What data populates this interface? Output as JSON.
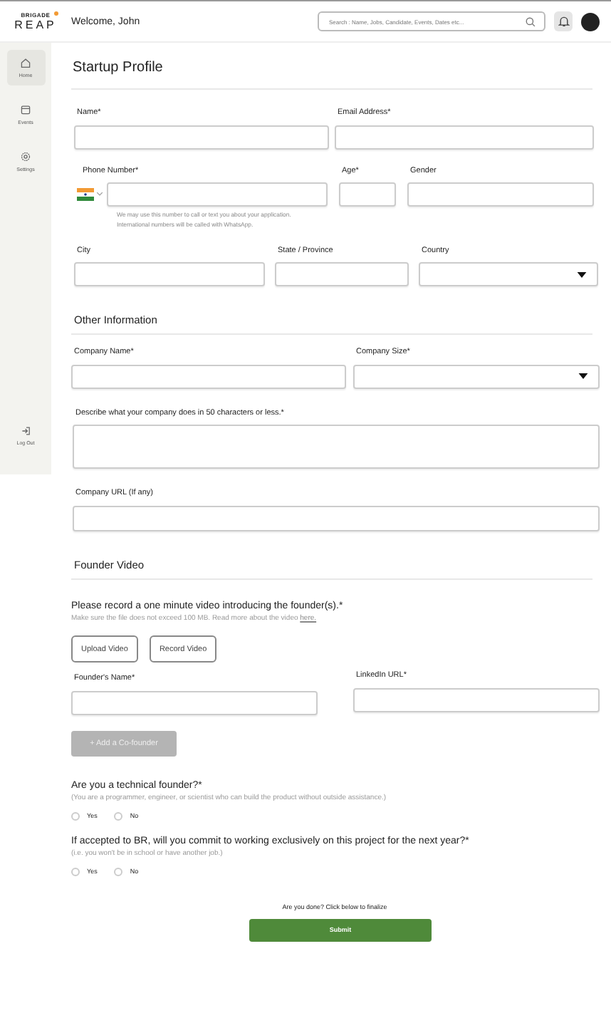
{
  "header": {
    "logo_top": "BRIGADE",
    "logo_bottom": "REAP",
    "welcome": "Welcome, John",
    "search_placeholder": "Search : Name, Jobs, Candidate, Events, Dates etc..."
  },
  "sidebar": {
    "items": [
      {
        "label": "Home",
        "kind": "home",
        "selected": true
      },
      {
        "label": "Events",
        "kind": "calendar",
        "selected": false
      },
      {
        "label": "Settings",
        "kind": "gear",
        "selected": false
      }
    ],
    "logout": "Log Out"
  },
  "form": {
    "title": "Startup Profile",
    "row_1": [
      {
        "label": "Name*",
        "kind": "text"
      },
      {
        "label": "Email Address*",
        "kind": "text"
      }
    ],
    "phone": {
      "label": "Phone Number*",
      "help": "We may use this number to call or text you about your application. International numbers will be called with WhatsApp."
    },
    "row_2": [
      {
        "label": "Age*",
        "kind": "text"
      },
      {
        "label": "Gender",
        "kind": "text"
      }
    ],
    "row_3": [
      {
        "label": "City",
        "kind": "text"
      },
      {
        "label": "State / Province",
        "kind": "text"
      },
      {
        "label": "Country",
        "kind": "select"
      }
    ],
    "other_heading": "Other Information",
    "row_4": [
      {
        "label": "Company Name*",
        "kind": "text"
      },
      {
        "label": "Company Size*",
        "kind": "select"
      }
    ],
    "describe": {
      "label": "Describe what your company does in 50 characters or less.*",
      "kind": "textarea"
    },
    "url": {
      "label": "Company URL (If any)",
      "kind": "text"
    },
    "video_heading": "Founder Video",
    "video_prompt": "Please record a one minute video introducing the founder(s).*",
    "video_note": "Make sure the file does not exceed 100 MB. Read more about the video",
    "video_link": "here.",
    "video_buttons": [
      "Upload Video",
      "Record Video"
    ],
    "row_5": [
      {
        "label": "Founder's Name*",
        "kind": "text"
      },
      {
        "label": "LinkedIn URL*",
        "kind": "text"
      }
    ],
    "add_cofounder": {
      "label": "+ Add a Co-founder",
      "disabled": true
    },
    "questions": [
      {
        "title": "Are you a technical founder?*",
        "note": "(You are a programmer, engineer, or scientist who can build the product without outside assistance.)",
        "options": [
          {
            "label": "Yes",
            "selected": false
          },
          {
            "label": "No",
            "selected": false
          }
        ]
      },
      {
        "title": "If accepted to BR, will you commit to working exclusively on this project for the next year?*",
        "note": "(i.e. you won't be in school or have another job.)",
        "options": [
          {
            "label": "Yes",
            "selected": false
          },
          {
            "label": "No",
            "selected": false
          }
        ]
      }
    ],
    "done_text": "Are you done? Click below to finalize",
    "submit": "Submit"
  }
}
